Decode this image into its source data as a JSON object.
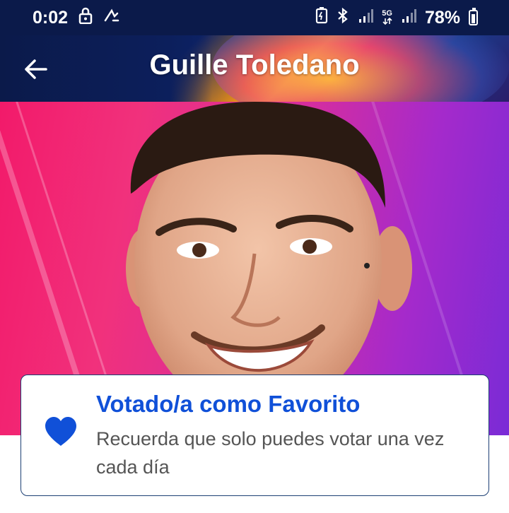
{
  "status_bar": {
    "time": "0:02",
    "network": "5G",
    "battery": "78%"
  },
  "header": {
    "title": "Guille Toledano",
    "back_icon": "arrow-left-icon"
  },
  "card": {
    "title": "Votado/a como Favorito",
    "message": "Recuerda que solo puedes votar una vez cada día",
    "icon": "heart-icon",
    "accent_color": "#1050d8"
  }
}
